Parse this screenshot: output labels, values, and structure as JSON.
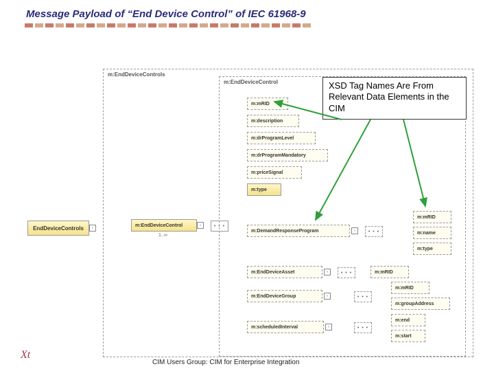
{
  "title": "Message Payload of “End Device Control” of IEC 61968-9",
  "callout": "XSD Tag Names Are From Relevant Data Elements in the CIM",
  "footer": "CIM Users Group: CIM for Enterprise Integration",
  "logo": "Xt",
  "diagram": {
    "outer": "m:EndDeviceControls",
    "inner": "m:EndDeviceControl",
    "root": "EndDeviceControls",
    "midControl": "m:EndDeviceControl",
    "multiplicity": "1..∞",
    "leaves": [
      "m:mRID",
      "m:description",
      "m:drProgramLevel",
      "m:drProgramMandatory",
      "m:priceSignal",
      "m:type"
    ],
    "drp": {
      "label": "m:DemandResponseProgram",
      "children": [
        "m:mRID",
        "m:name",
        "m:type"
      ]
    },
    "asset": {
      "label": "m:EndDeviceAsset",
      "child": "m:mRID"
    },
    "group": {
      "label": "m:EndDeviceGroup",
      "children": [
        "m:mRID",
        "m:groupAddress"
      ]
    },
    "sched": {
      "label": "m:scheduledInterval",
      "children": [
        "m:end",
        "m:start"
      ]
    }
  }
}
